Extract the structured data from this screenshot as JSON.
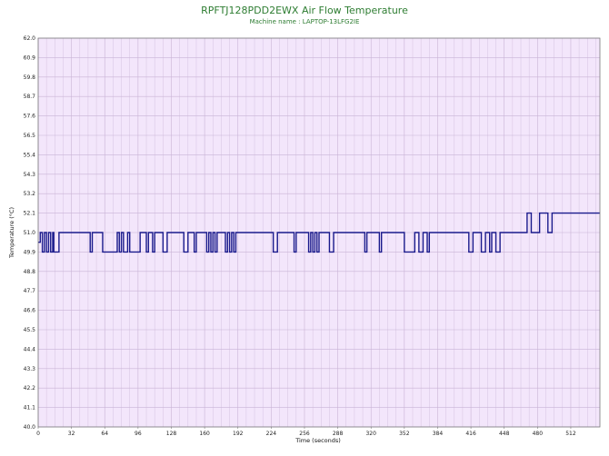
{
  "chart_data": {
    "type": "line",
    "title": "RPFTJ128PDD2EWX Air Flow Temperature",
    "subtitle": "Machine name : LAPTOP-13LFG2IE",
    "xlabel": "Time (seconds)",
    "ylabel": "Temperature (°C)",
    "xlim": [
      0,
      540
    ],
    "ylim": [
      40.0,
      62.0
    ],
    "x_ticks": [
      0,
      32,
      64,
      96,
      128,
      160,
      192,
      224,
      256,
      288,
      320,
      352,
      384,
      416,
      448,
      480,
      512
    ],
    "y_ticks": [
      40.0,
      41.1,
      42.2,
      43.3,
      44.4,
      45.5,
      46.6,
      47.7,
      48.8,
      49.9,
      51.0,
      52.1,
      53.2,
      54.3,
      55.4,
      56.5,
      57.6,
      58.7,
      59.8,
      60.9,
      62.0
    ],
    "grid": true,
    "background_color": "#f3e6fb",
    "grid_color": "#c9b3d6",
    "line_color": "#1a1a8c",
    "series": [
      {
        "step": true,
        "x": [
          0,
          2,
          4,
          6,
          8,
          10,
          12,
          14,
          15,
          20,
          30,
          50,
          52,
          60,
          62,
          76,
          78,
          80,
          82,
          86,
          88,
          98,
          100,
          104,
          106,
          110,
          112,
          120,
          124,
          140,
          144,
          150,
          152,
          162,
          164,
          166,
          168,
          170,
          172,
          180,
          182,
          184,
          186,
          188,
          190,
          196,
          200,
          226,
          230,
          232,
          234,
          246,
          248,
          260,
          262,
          264,
          266,
          268,
          270,
          280,
          284,
          312,
          314,
          316,
          318,
          328,
          330,
          350,
          352,
          362,
          366,
          370,
          374,
          376,
          378,
          402,
          404,
          414,
          418,
          426,
          430,
          434,
          436,
          440,
          444,
          454,
          456,
          470,
          474,
          478,
          482,
          490,
          494,
          498,
          500,
          504,
          540
        ],
        "y": [
          50.45,
          51.0,
          49.9,
          51.0,
          49.9,
          51.0,
          49.9,
          51.0,
          49.9,
          51.0,
          51.0,
          49.9,
          51.0,
          51.0,
          49.9,
          51.0,
          49.9,
          51.0,
          49.9,
          51.0,
          49.9,
          51.0,
          51.0,
          49.9,
          51.0,
          49.9,
          51.0,
          49.9,
          51.0,
          49.9,
          51.0,
          49.9,
          51.0,
          49.9,
          51.0,
          49.9,
          51.0,
          49.9,
          51.0,
          49.9,
          51.0,
          49.9,
          51.0,
          49.9,
          51.0,
          51.0,
          51.0,
          49.9,
          51.0,
          51.0,
          51.0,
          49.9,
          51.0,
          49.9,
          51.0,
          49.9,
          51.0,
          49.9,
          51.0,
          49.9,
          51.0,
          51.0,
          49.9,
          51.0,
          51.0,
          49.9,
          51.0,
          51.0,
          49.9,
          51.0,
          49.9,
          51.0,
          49.9,
          51.0,
          51.0,
          51.0,
          51.0,
          49.9,
          51.0,
          49.9,
          51.0,
          49.9,
          51.0,
          49.9,
          51.0,
          51.0,
          51.0,
          52.1,
          51.0,
          51.0,
          52.1,
          51.0,
          52.1,
          52.1,
          52.1,
          52.1,
          52.1
        ]
      }
    ]
  }
}
